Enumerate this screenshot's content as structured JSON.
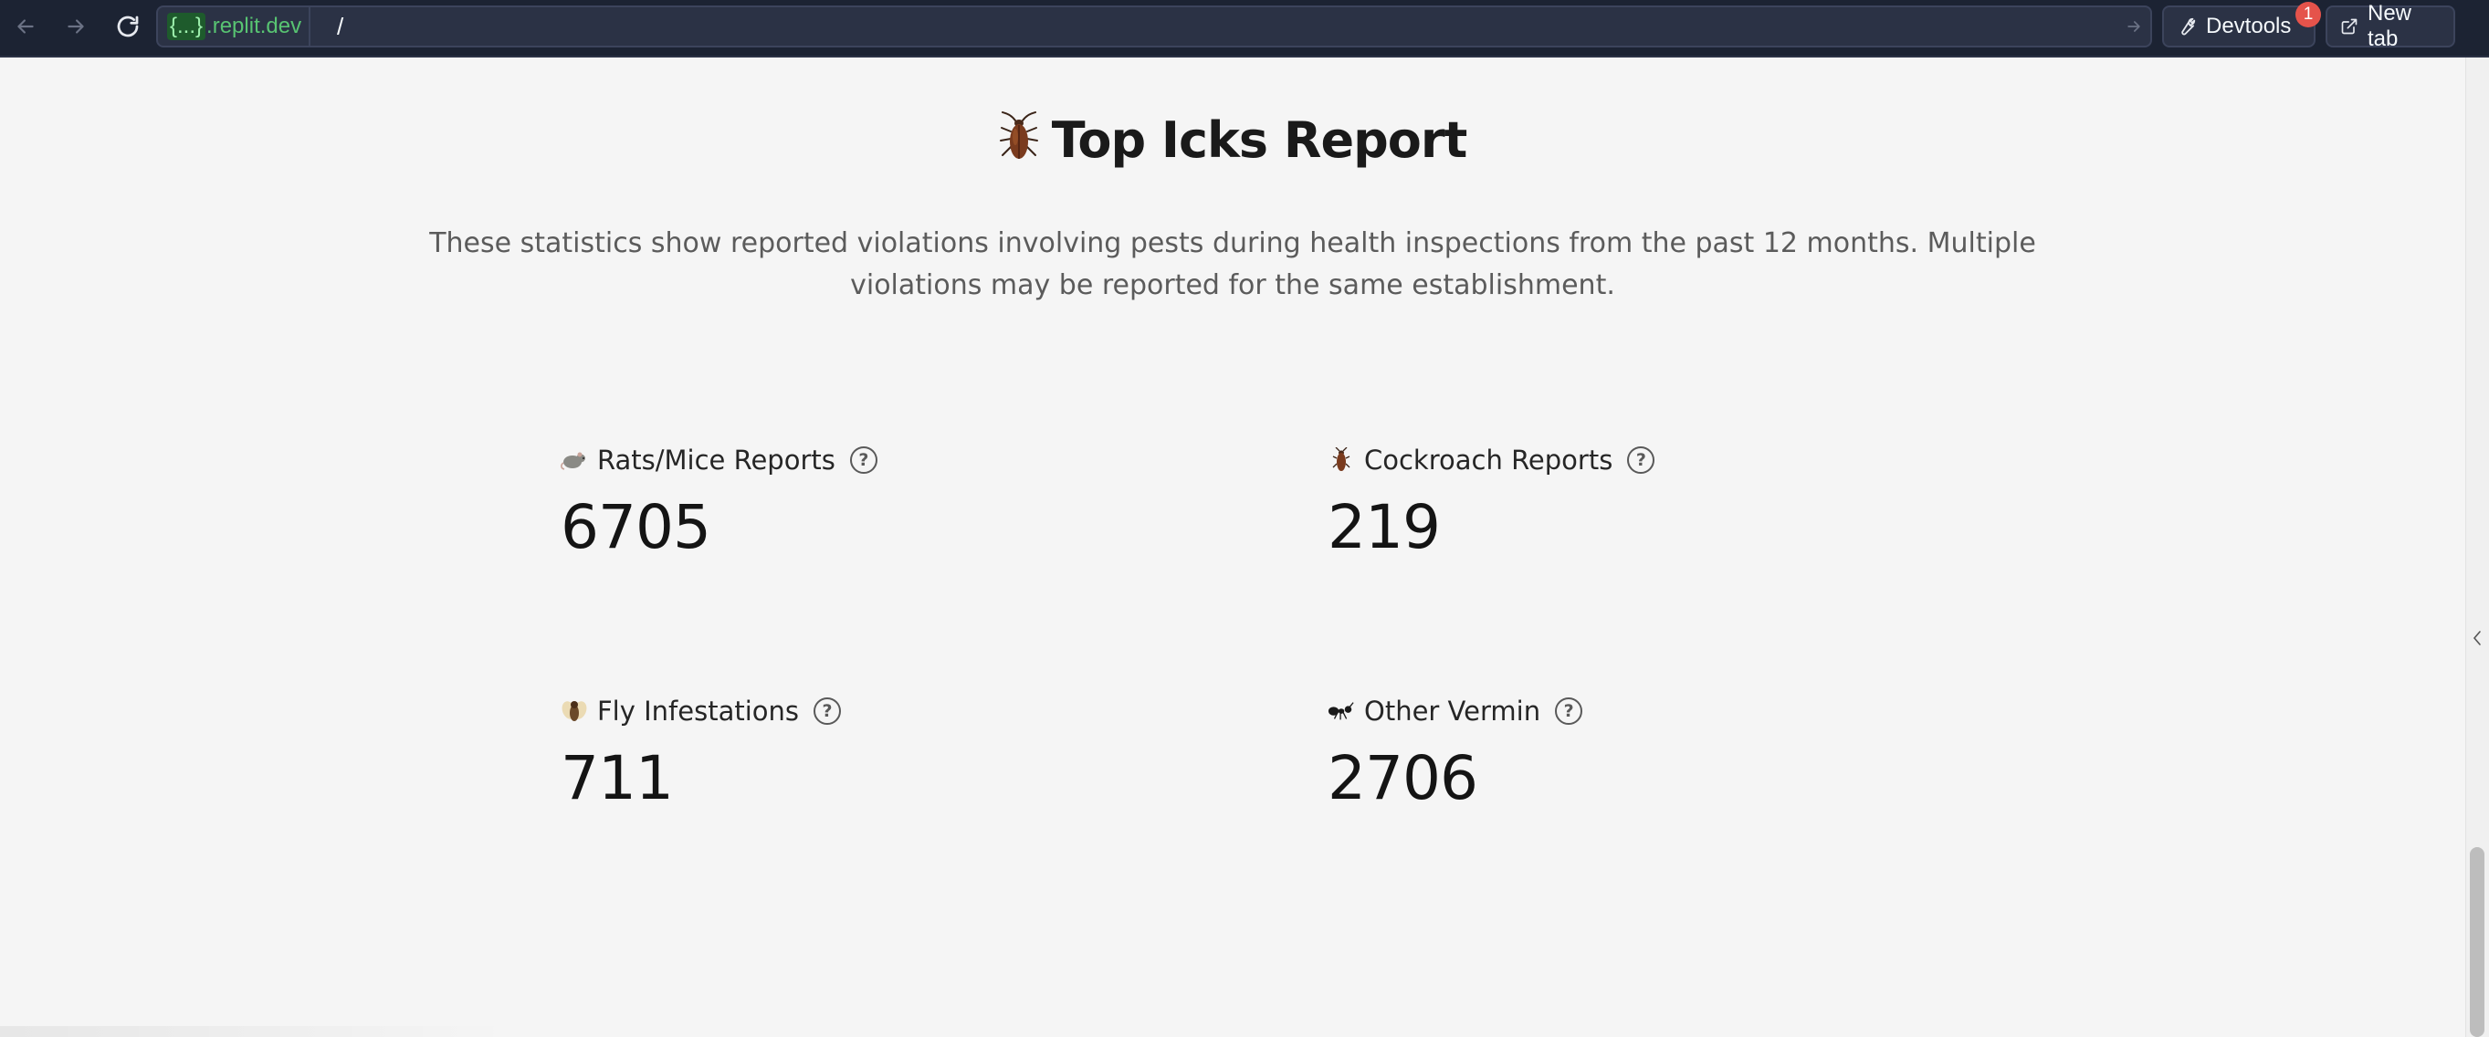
{
  "browser": {
    "domain_placeholder": "{...}",
    "domain_suffix": ".replit.dev",
    "path": "/",
    "devtools_label": "Devtools",
    "devtools_badge": "1",
    "new_tab_label": "New tab"
  },
  "page": {
    "title": "Top Icks Report",
    "intro": "These statistics show reported violations involving pests during health inspections from the past 12 months. Multiple violations may be reported for the same establishment.",
    "help_glyph": "?"
  },
  "stats": [
    {
      "label": "Rats/Mice Reports",
      "value": "6705",
      "icon": "rat-icon"
    },
    {
      "label": "Cockroach Reports",
      "value": "219",
      "icon": "cockroach-icon"
    },
    {
      "label": "Fly Infestations",
      "value": "711",
      "icon": "fly-icon"
    },
    {
      "label": "Other Vermin",
      "value": "2706",
      "icon": "ant-icon"
    }
  ],
  "colors": {
    "chrome_bg": "#1c2333",
    "page_bg": "#f5f5f5",
    "domain_green": "#58c472",
    "badge_red": "#e5534b"
  }
}
